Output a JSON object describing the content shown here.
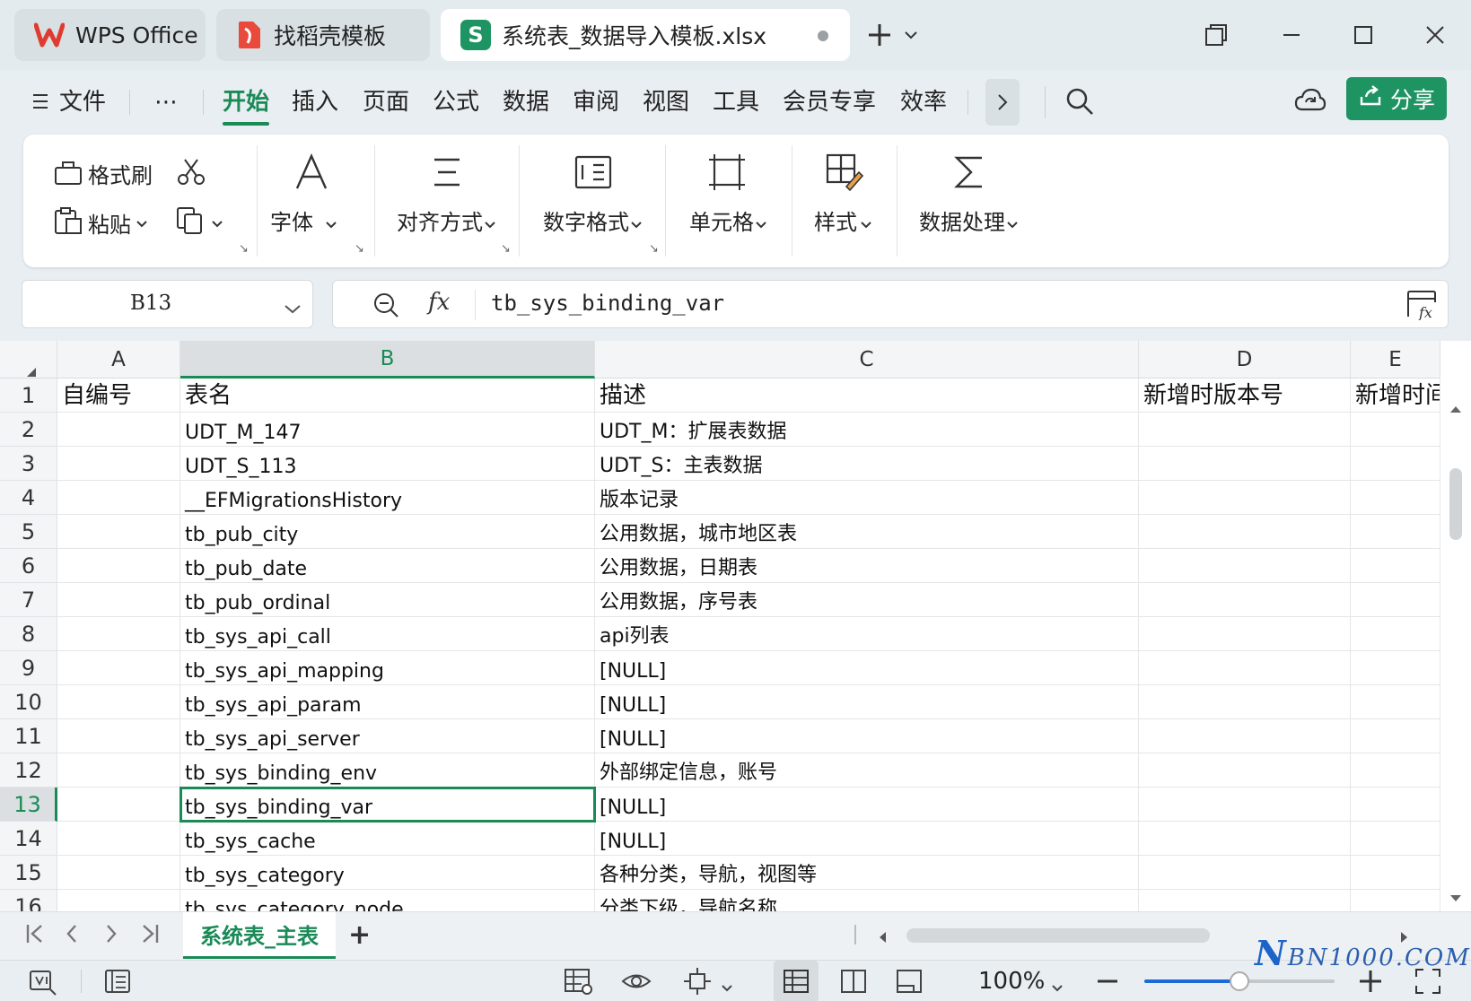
{
  "titlebar": {
    "tabs": [
      {
        "label": "WPS Office",
        "icon": "wps-logo-icon",
        "color": "#e03b2f"
      },
      {
        "label": "找稻壳模板",
        "icon": "docer-icon",
        "color": "#e94a3c"
      },
      {
        "label": "系统表_数据导入模板.xlsx",
        "icon": "spreadsheet-s-icon",
        "icon_text": "S",
        "color": "#1f9463"
      }
    ]
  },
  "menubar": {
    "file_label": "文件",
    "more_label": "⋯",
    "items": [
      "开始",
      "插入",
      "页面",
      "公式",
      "数据",
      "审阅",
      "视图",
      "工具",
      "会员专享",
      "效率"
    ],
    "active_index": 0,
    "share_label": "分享"
  },
  "ribbon": {
    "format_painter": "格式刷",
    "paste": "粘贴",
    "font": "字体",
    "align": "对齐方式",
    "number_format": "数字格式",
    "cells": "单元格",
    "styles": "样式",
    "data_process": "数据处理"
  },
  "formula_bar": {
    "name_box": "B13",
    "fx": "fx",
    "content": "tb_sys_binding_var"
  },
  "grid": {
    "columns": [
      "A",
      "B",
      "C",
      "D",
      "E"
    ],
    "selected_column": "B",
    "selected_row": "13",
    "row_numbers": [
      "1",
      "2",
      "3",
      "4",
      "5",
      "6",
      "7",
      "8",
      "9",
      "10",
      "11",
      "12",
      "13",
      "14",
      "15",
      "16"
    ],
    "rows": [
      [
        "自编号",
        "表名",
        "描述",
        "新增时版本号",
        "新增时间"
      ],
      [
        "",
        "UDT_M_147",
        "UDT_M：扩展表数据",
        "",
        ""
      ],
      [
        "",
        "UDT_S_113",
        "UDT_S：主表数据",
        "",
        ""
      ],
      [
        "",
        "__EFMigrationsHistory",
        "版本记录",
        "",
        ""
      ],
      [
        "",
        "tb_pub_city",
        "公用数据，城市地区表",
        "",
        ""
      ],
      [
        "",
        "tb_pub_date",
        "公用数据，日期表",
        "",
        ""
      ],
      [
        "",
        "tb_pub_ordinal",
        "公用数据，序号表",
        "",
        ""
      ],
      [
        "",
        "tb_sys_api_call",
        "api列表",
        "",
        ""
      ],
      [
        "",
        "tb_sys_api_mapping",
        "[NULL]",
        "",
        ""
      ],
      [
        "",
        "tb_sys_api_param",
        "[NULL]",
        "",
        ""
      ],
      [
        "",
        "tb_sys_api_server",
        "[NULL]",
        "",
        ""
      ],
      [
        "",
        "tb_sys_binding_env",
        "外部绑定信息，账号",
        "",
        ""
      ],
      [
        "",
        "tb_sys_binding_var",
        "[NULL]",
        "",
        ""
      ],
      [
        "",
        "tb_sys_cache",
        "[NULL]",
        "",
        ""
      ],
      [
        "",
        "tb_sys_category",
        "各种分类，导航，视图等",
        "",
        ""
      ],
      [
        "",
        "tb_sys_category_node",
        "分类下级，导航名称",
        "",
        ""
      ]
    ]
  },
  "sheetbar": {
    "sheet_name": "系统表_主表",
    "add_label": "+"
  },
  "statusbar": {
    "zoom": "100%",
    "zoom_value": 0.5
  },
  "watermark": {
    "big": "N",
    "text": "BN1000.COM"
  },
  "colors": {
    "accent": "#1a8a56",
    "share": "#1f9463"
  }
}
